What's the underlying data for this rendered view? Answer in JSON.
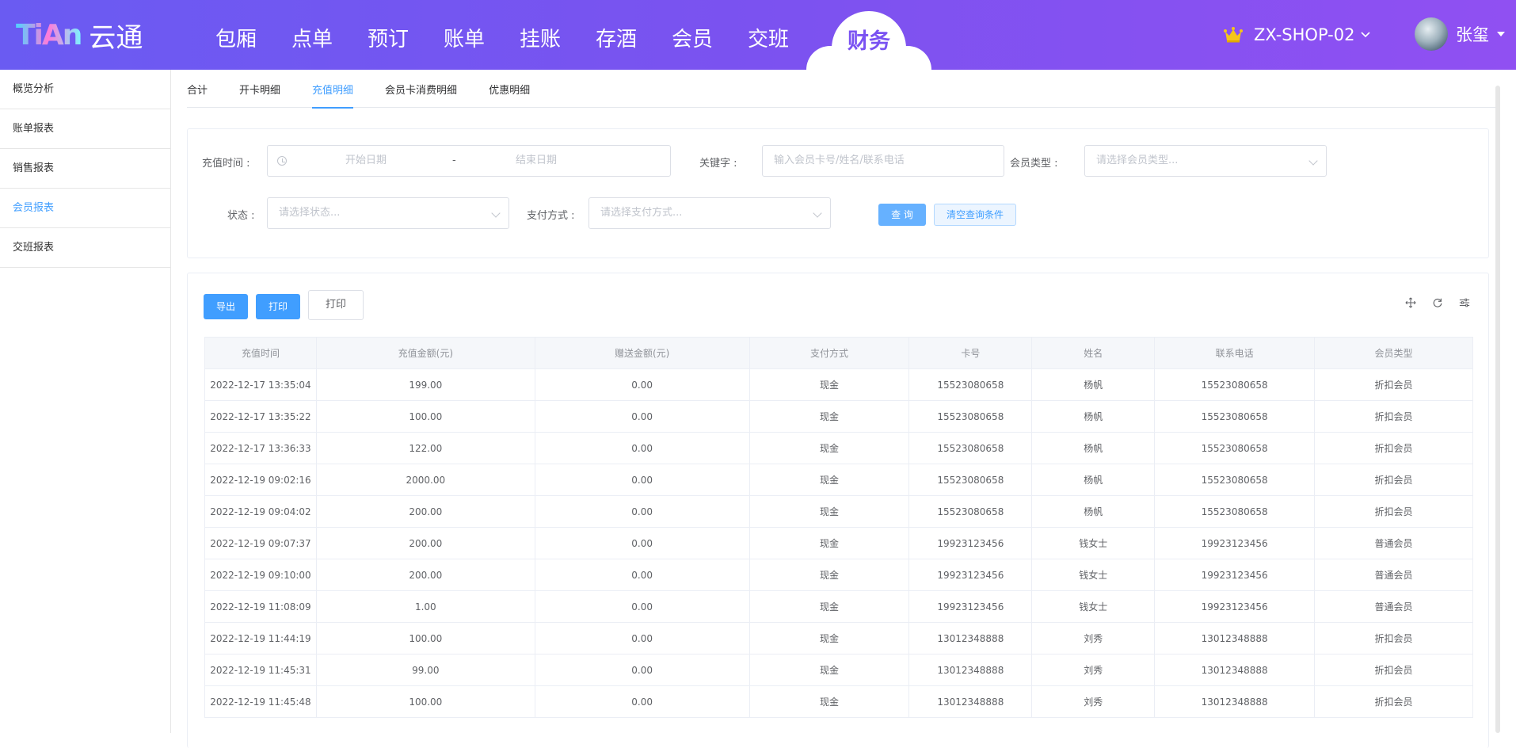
{
  "header": {
    "logo_mark": "TiAn",
    "logo_text": "云通",
    "nav": [
      "包厢",
      "点单",
      "预订",
      "账单",
      "挂账",
      "存酒",
      "会员",
      "交班"
    ],
    "nav_active": "财务",
    "shop": "ZX-SHOP-02",
    "user": "张玺",
    "crown_color": "#f5c518"
  },
  "sidebar": {
    "items": [
      "概览分析",
      "账单报表",
      "销售报表",
      "会员报表",
      "交班报表"
    ],
    "active_index": 3
  },
  "tabs": {
    "items": [
      "合计",
      "开卡明细",
      "充值明细",
      "会员卡消费明细",
      "优惠明细"
    ],
    "active_index": 2
  },
  "filter": {
    "time_label": "充值时间 :",
    "start_placeholder": "开始日期",
    "range_sep": "-",
    "end_placeholder": "结束日期",
    "keyword_label": "关键字 :",
    "keyword_placeholder": "输入会员卡号/姓名/联系电话",
    "member_type_label": "会员类型 :",
    "member_type_placeholder": "请选择会员类型...",
    "status_label": "状态 :",
    "status_placeholder": "请选择状态...",
    "pay_label": "支付方式 :",
    "pay_placeholder": "请选择支付方式...",
    "query_btn": "查 询",
    "clear_btn": "清空查询条件"
  },
  "toolbar": {
    "export": "导出",
    "print1": "打印",
    "print2": "打印"
  },
  "table": {
    "headers": [
      "充值时间",
      "充值金额(元)",
      "赠送金额(元)",
      "支付方式",
      "卡号",
      "姓名",
      "联系电话",
      "会员类型"
    ],
    "rows": [
      [
        "2022-12-17 13:35:04",
        "199.00",
        "0.00",
        "现金",
        "15523080658",
        "杨帆",
        "15523080658",
        "折扣会员"
      ],
      [
        "2022-12-17 13:35:22",
        "100.00",
        "0.00",
        "现金",
        "15523080658",
        "杨帆",
        "15523080658",
        "折扣会员"
      ],
      [
        "2022-12-17 13:36:33",
        "122.00",
        "0.00",
        "现金",
        "15523080658",
        "杨帆",
        "15523080658",
        "折扣会员"
      ],
      [
        "2022-12-19 09:02:16",
        "2000.00",
        "0.00",
        "现金",
        "15523080658",
        "杨帆",
        "15523080658",
        "折扣会员"
      ],
      [
        "2022-12-19 09:04:02",
        "200.00",
        "0.00",
        "现金",
        "15523080658",
        "杨帆",
        "15523080658",
        "折扣会员"
      ],
      [
        "2022-12-19 09:07:37",
        "200.00",
        "0.00",
        "现金",
        "19923123456",
        "钱女士",
        "19923123456",
        "普通会员"
      ],
      [
        "2022-12-19 09:10:00",
        "200.00",
        "0.00",
        "现金",
        "19923123456",
        "钱女士",
        "19923123456",
        "普通会员"
      ],
      [
        "2022-12-19 11:08:09",
        "1.00",
        "0.00",
        "现金",
        "19923123456",
        "钱女士",
        "19923123456",
        "普通会员"
      ],
      [
        "2022-12-19 11:44:19",
        "100.00",
        "0.00",
        "现金",
        "13012348888",
        "刘秀",
        "13012348888",
        "折扣会员"
      ],
      [
        "2022-12-19 11:45:31",
        "99.00",
        "0.00",
        "现金",
        "13012348888",
        "刘秀",
        "13012348888",
        "折扣会员"
      ],
      [
        "2022-12-19 11:45:48",
        "100.00",
        "0.00",
        "现金",
        "13012348888",
        "刘秀",
        "13012348888",
        "折扣会员"
      ]
    ]
  }
}
